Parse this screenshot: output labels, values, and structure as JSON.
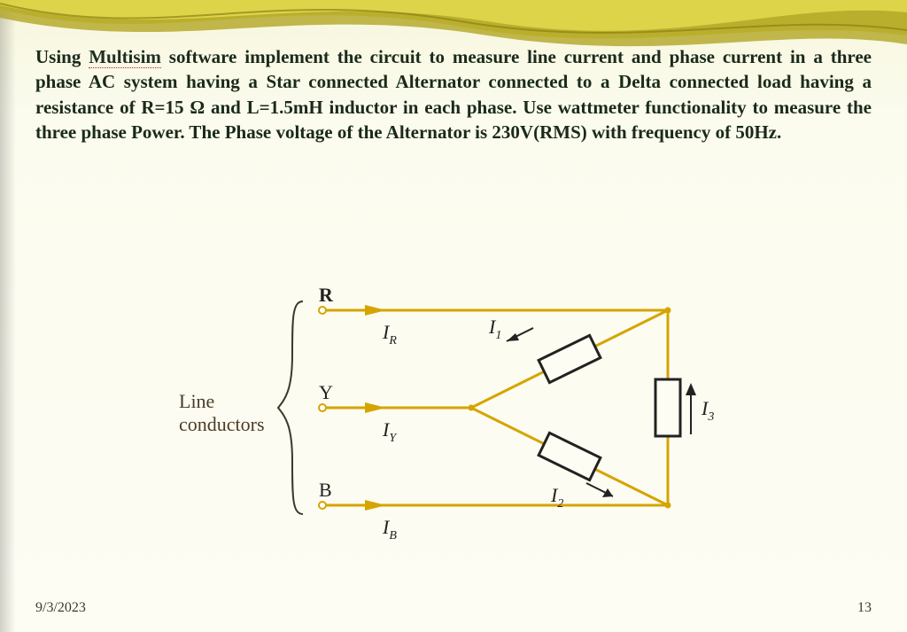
{
  "prompt": {
    "t1": "Using ",
    "multisim": "Multisim",
    "t2": " software implement the circuit to measure line current  and phase current in a three phase AC system having a Star connected Alternator connected to a Delta connected load having a resistance of R=15 Ω and L=1.5mH inductor in each phase. Use wattmeter functionality to measure the three phase Power. The Phase voltage of the Alternator is 230V(RMS) with frequency of 50Hz."
  },
  "diagram": {
    "line_label_1": "Line",
    "line_label_2": "conductors",
    "terminals": {
      "R": "R",
      "Y": "Y",
      "B": "B"
    },
    "line_currents": {
      "IR": "I",
      "IR_sub": "R",
      "IY": "I",
      "IY_sub": "Y",
      "IB": "I",
      "IB_sub": "B"
    },
    "phase_currents": {
      "I1": "I",
      "I1_sub": "1",
      "I2": "I",
      "I2_sub": "2",
      "I3": "I",
      "I3_sub": "3"
    }
  },
  "footer": {
    "date": "9/3/2023",
    "page": "13"
  }
}
